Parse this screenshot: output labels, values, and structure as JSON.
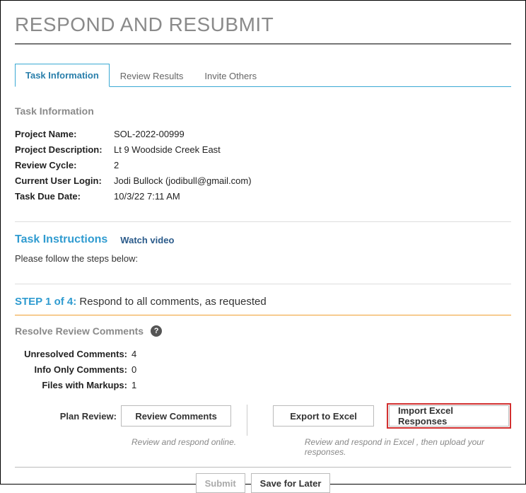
{
  "page": {
    "title": "RESPOND AND RESUBMIT"
  },
  "tabs": [
    {
      "label": "Task Information",
      "active": true
    },
    {
      "label": "Review Results",
      "active": false
    },
    {
      "label": "Invite Others",
      "active": false
    }
  ],
  "task_info": {
    "section_label": "Task Information",
    "rows": {
      "project_name": {
        "label": "Project Name:",
        "value": "SOL-2022-00999"
      },
      "project_description": {
        "label": "Project Description:",
        "value": "Lt 9 Woodside Creek East"
      },
      "review_cycle": {
        "label": "Review Cycle:",
        "value": "2"
      },
      "current_user": {
        "label": "Current User Login:",
        "value": "Jodi Bullock (jodibull@gmail.com)"
      },
      "due_date": {
        "label": "Task Due Date:",
        "value": "10/3/22 7:11 AM"
      }
    }
  },
  "instructions": {
    "title": "Task Instructions",
    "watch_video": "Watch video",
    "text": "Please follow the steps below:"
  },
  "step": {
    "num": "STEP 1 of 4:",
    "text": "Respond to all comments, as requested"
  },
  "resolve": {
    "title": "Resolve Review Comments",
    "help_icon": "?",
    "counts": {
      "unresolved": {
        "label": "Unresolved Comments:",
        "value": "4"
      },
      "info_only": {
        "label": "Info Only Comments:",
        "value": "0"
      },
      "markups": {
        "label": "Files with Markups:",
        "value": "1"
      }
    },
    "plan_review_label": "Plan Review:",
    "buttons": {
      "review_comments": "Review Comments",
      "export_excel": "Export to Excel",
      "import_excel": "Import Excel Responses"
    },
    "helpers": {
      "left": "Review and respond online.",
      "right": "Review and respond in Excel , then upload your responses."
    }
  },
  "footer": {
    "submit": "Submit",
    "save": "Save for Later"
  }
}
